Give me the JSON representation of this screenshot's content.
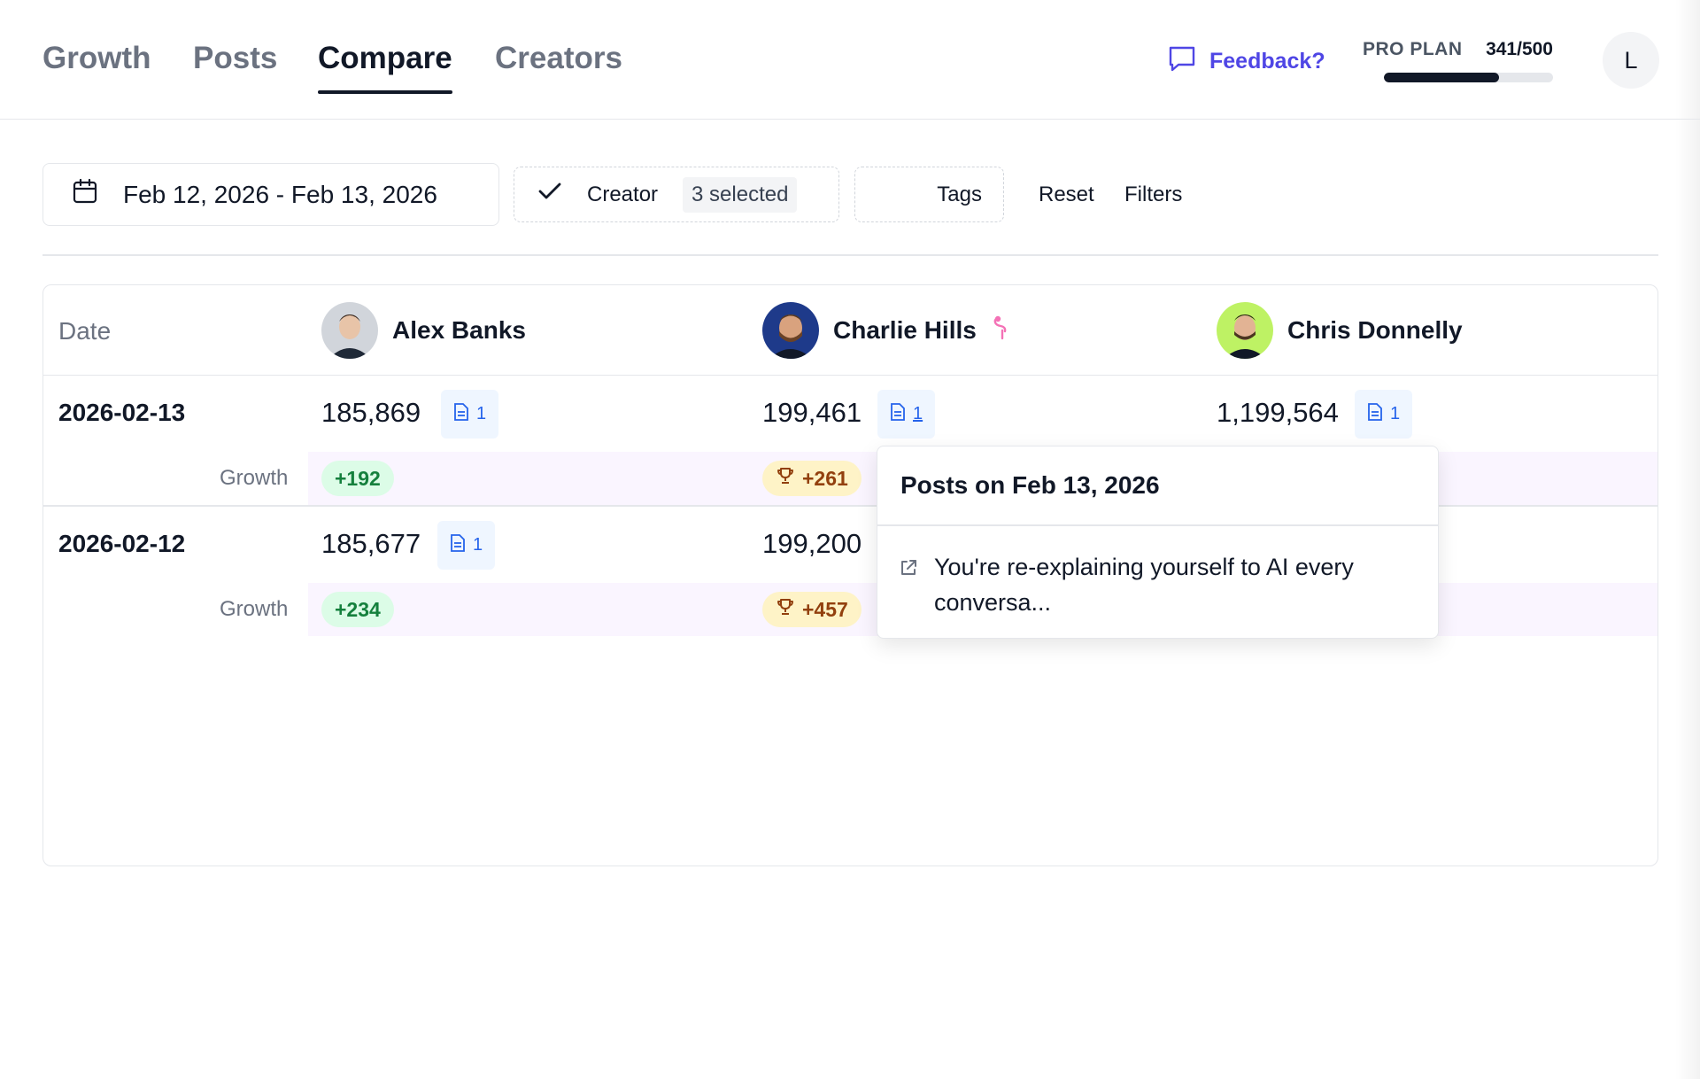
{
  "nav": {
    "tabs": [
      {
        "label": "Growth",
        "active": false
      },
      {
        "label": "Posts",
        "active": false
      },
      {
        "label": "Compare",
        "active": true
      },
      {
        "label": "Creators",
        "active": false
      }
    ]
  },
  "header": {
    "feedback_label": "Feedback?",
    "plan_label": "PRO PLAN",
    "plan_usage": "341/500",
    "plan_progress": 0.682,
    "user_initial": "L"
  },
  "filters": {
    "date_range": "Feb 12, 2026 - Feb 13, 2026",
    "creator_label": "Creator",
    "creator_selected": "3 selected",
    "tags_label": "Tags",
    "reset_label": "Reset",
    "filters_label": "Filters"
  },
  "table": {
    "date_header": "Date",
    "growth_label": "Growth",
    "creators": [
      {
        "name": "Alex Banks",
        "badge": ""
      },
      {
        "name": "Charlie Hills",
        "badge": "flamingo"
      },
      {
        "name": "Chris Donnelly",
        "badge": ""
      }
    ],
    "rows": [
      {
        "date": "2026-02-13",
        "values": [
          "185,869",
          "199,461",
          "1,199,564"
        ],
        "post_counts": [
          "1",
          "1",
          "1"
        ],
        "growth": [
          "+192",
          "+261",
          ""
        ],
        "growth_top": [
          false,
          true,
          false
        ]
      },
      {
        "date": "2026-02-12",
        "values": [
          "185,677",
          "199,200",
          ""
        ],
        "post_counts": [
          "1",
          "",
          ""
        ],
        "growth": [
          "+234",
          "+457",
          ""
        ],
        "growth_top": [
          false,
          true,
          false
        ]
      }
    ]
  },
  "popover": {
    "title": "Posts on Feb 13, 2026",
    "items": [
      "You're re-explaining yourself to AI every conversa..."
    ]
  },
  "colors": {
    "accent": "#4f46e5",
    "growth_band": "#faf5ff",
    "growth_green": "#15803d",
    "growth_gold": "#92400e",
    "doc_badge": "#2563eb"
  }
}
